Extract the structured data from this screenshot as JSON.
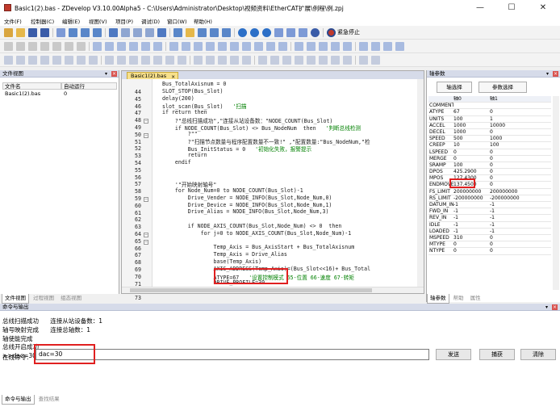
{
  "window": {
    "title": "Basic1(2).bas - ZDevelop V3.10.00Alpha5 - C:\\Users\\Administrator\\Desktop\\视频资料\\EtherCAT扩展\\例程\\例.zpj",
    "minimize": "—",
    "maximize": "☐",
    "close": "✕"
  },
  "menu": [
    "文件(F)",
    "控制器(C)",
    "编辑(E)",
    "视图(V)",
    "项目(P)",
    "调试(D)",
    "窗口(W)",
    "帮助(H)"
  ],
  "toolbar": {
    "estop_label": "紧急停止"
  },
  "file_panel": {
    "title": "文件视图",
    "columns": [
      "文件名",
      "自动运行"
    ],
    "rows": [
      [
        "Basic1(2).bas",
        "0"
      ]
    ],
    "tabs": [
      "文件视图",
      "过程视图",
      "组态视图"
    ]
  },
  "editor": {
    "tab": "Basic1(2).bas",
    "lines": [
      {
        "n": "44",
        "code": "Bus_TotalAxisnum = 0"
      },
      {
        "n": "45",
        "code": "SLOT_STOP(Bus_Slot)"
      },
      {
        "n": "46",
        "code": "delay(200)"
      },
      {
        "n": "47",
        "code": "slot_scan(Bus_Slot)",
        "comment": "'扫描"
      },
      {
        "n": "48",
        "code": "if return then"
      },
      {
        "n": "49",
        "code": "    ?\"总线扫描成功\",\"连接从站设备数：\"NODE_COUNT(Bus_Slot)"
      },
      {
        "n": "50",
        "code": "    if NODE_COUNT(Bus_Slot) <> Bus_NodeNum  then",
        "comment": "'判断总线检测"
      },
      {
        "n": "51",
        "code": "        ?\"\""
      },
      {
        "n": "52",
        "code": "        ?\"扫描节点数量与程序配置数量不一致!\" ,\"配置数量:\"Bus_NodeNum,\"检"
      },
      {
        "n": "53",
        "code": "        Bus_InitStatus = 0",
        "comment": "'初始化失败，报警提示"
      },
      {
        "n": "54",
        "code": "        return"
      },
      {
        "n": "55",
        "code": "    endif"
      },
      {
        "n": "56",
        "code": ""
      },
      {
        "n": "57",
        "code": ""
      },
      {
        "n": "58",
        "code": "    '\"开始映射轴号\""
      },
      {
        "n": "59",
        "code": "    for Node_Num=0 to NODE_COUNT(Bus_Slot)-1"
      },
      {
        "n": "60",
        "code": "        Drive_Vender = NODE_INFO(Bus_Slot,Node_Num,0)"
      },
      {
        "n": "61",
        "code": "        Drive_Device = NODE_INFO(Bus_Slot,Node_Num,1)"
      },
      {
        "n": "62",
        "code": "        Drive_Alias = NODE_INFO(Bus_Slot,Node_Num,3)"
      },
      {
        "n": "63",
        "code": ""
      },
      {
        "n": "64",
        "code": "        if NODE_AXIS_COUNT(Bus_Slot,Node_Num) <> 0  then"
      },
      {
        "n": "65",
        "code": "            for j=0 to NODE_AXIS_COUNT(Bus_Slot,Node_Num)-1"
      },
      {
        "n": "66",
        "code": ""
      },
      {
        "n": "67",
        "code": "                Temp_Axis = Bus_AxisStart + Bus_TotalAxisnum"
      },
      {
        "n": "68",
        "code": "                Temp_Axis = Drive_Alias"
      },
      {
        "n": "69",
        "code": "                base(Temp_Axis)"
      },
      {
        "n": "70",
        "code": "                AXIS_ADDRESS(Temp_Axis)=(Bus_Slot<<16)+ Bus_Total"
      },
      {
        "n": "71",
        "code": "                ATYPE=67",
        "comment": "'设置控制模式 65-位置 66-速度 67-转矩"
      },
      {
        "n": "72",
        "code": "                DRIVE_PROFILE=30"
      },
      {
        "n": "73",
        "code": ""
      }
    ]
  },
  "axis_panel": {
    "title": "轴参数",
    "select_axis": "轴选择",
    "select_param": "参数选择",
    "columns": [
      "",
      "轴0",
      "轴1"
    ],
    "rows": [
      [
        "COMMENT",
        "",
        ""
      ],
      [
        "ATYPE",
        "67",
        "0"
      ],
      [
        "UNITS",
        "100",
        "1"
      ],
      [
        "ACCEL",
        "1000",
        "10000"
      ],
      [
        "DECEL",
        "1000",
        "0"
      ],
      [
        "SPEED",
        "500",
        "1000"
      ],
      [
        "CREEP",
        "10",
        "100"
      ],
      [
        "LSPEED",
        "0",
        "0"
      ],
      [
        "MERGE",
        "0",
        "0"
      ],
      [
        "SRAMP",
        "100",
        "0"
      ],
      [
        "DPOS",
        "425.2900",
        "0"
      ],
      [
        "MPOS",
        "127.4300",
        "0"
      ],
      [
        "ENDMOVE",
        "137.4500",
        "0"
      ],
      [
        "FS_LIMIT",
        "200000000",
        "200000000"
      ],
      [
        "RS_LIMIT",
        "-200000000",
        "-200000000"
      ],
      [
        "DATUM_IN",
        "-1",
        "-1"
      ],
      [
        "FWD_IN",
        "-1",
        "-1"
      ],
      [
        "REV_IN",
        "-1",
        "-1"
      ],
      [
        "IDLE",
        "-1",
        "-1"
      ],
      [
        "LOADED",
        "-1",
        "-1"
      ],
      [
        "MSPEED",
        "310",
        "0"
      ],
      [
        "MTYPE",
        "0",
        "0"
      ],
      [
        "NTYPE",
        "0",
        "0"
      ]
    ],
    "tabs": [
      "轴参数",
      "帮助",
      "属性"
    ]
  },
  "command": {
    "title": "命令与输出",
    "output": "总线扫描成功      连接从站设备数：1\n轴号映射完成      连接总轴数：1\n轴使能完成\n总线开启成功\n>>dac=30",
    "input_label": "在线命令:",
    "input_value": "dac=30",
    "send": "发送",
    "capture": "捕获",
    "clear": "清除",
    "tabs": [
      "命令与输出",
      "查找结果"
    ]
  }
}
